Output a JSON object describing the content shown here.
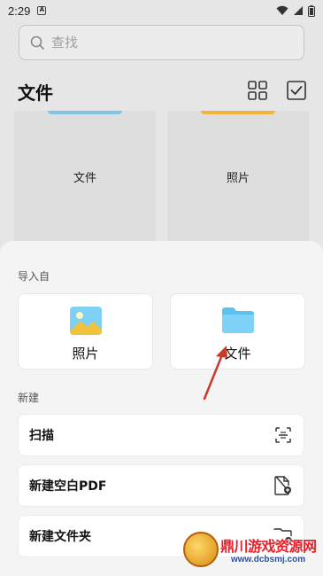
{
  "status_bar": {
    "time": "2:29",
    "notification_icon": "A"
  },
  "search": {
    "placeholder": "查找"
  },
  "header": {
    "title": "文件",
    "icons": [
      "grid-view-icon",
      "select-checkbox-icon"
    ]
  },
  "background_cards": [
    {
      "label": "文件",
      "accent": "#7fc4e8"
    },
    {
      "label": "照片",
      "accent": "#f2b53a"
    }
  ],
  "sheet": {
    "import_section": {
      "label": "导入自",
      "items": [
        {
          "label": "照片",
          "icon": "photo-icon"
        },
        {
          "label": "文件",
          "icon": "folder-icon"
        }
      ]
    },
    "new_section": {
      "label": "新建",
      "items": [
        {
          "label": "扫描",
          "icon": "scan-icon"
        },
        {
          "label": "新建空白PDF",
          "icon": "new-pdf-icon"
        },
        {
          "label": "新建文件夹",
          "icon": "new-folder-icon"
        }
      ]
    }
  },
  "watermark": {
    "title": "鼎川游戏资源网",
    "url": "www.dcbsmj.com"
  },
  "colors": {
    "accent_red": "#c83a2a",
    "folder_blue": "#5cc0f0",
    "photo_yellow": "#f2c238"
  }
}
